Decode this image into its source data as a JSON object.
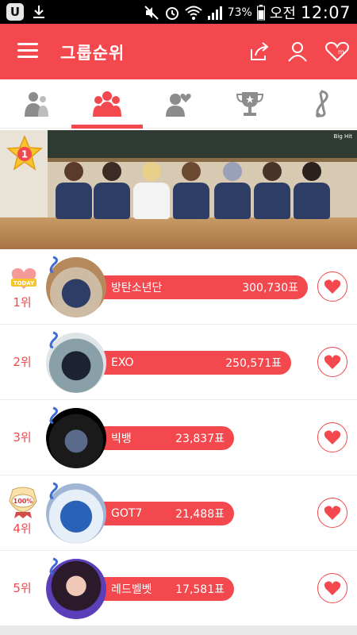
{
  "status_bar": {
    "battery": "73%",
    "ampm": "오전",
    "time": "12:07"
  },
  "header": {
    "title": "그룹순위"
  },
  "tabs": [
    {
      "icon": "individual-ranking-icon"
    },
    {
      "icon": "group-ranking-icon"
    },
    {
      "icon": "heart-person-icon"
    },
    {
      "icon": "trophy-icon"
    },
    {
      "icon": "music-note-icon"
    }
  ],
  "banner": {
    "tag": "Big Hit",
    "medal_number": "1"
  },
  "rankings": [
    {
      "rank": "1위",
      "name": "방탄소년단",
      "votes": "300,730표",
      "badge": "TODAY",
      "bar_fill": 0.59
    },
    {
      "rank": "2위",
      "name": "EXO",
      "votes": "250,571표",
      "badge": "",
      "bar_fill": 0.55
    },
    {
      "rank": "3위",
      "name": "빅뱅",
      "votes": "23,837표",
      "badge": "",
      "bar_fill": 0.39
    },
    {
      "rank": "4위",
      "name": "GOT7",
      "votes": "21,488표",
      "badge": "100%",
      "bar_fill": 0.39
    },
    {
      "rank": "5위",
      "name": "레드벨벳",
      "votes": "17,581표",
      "badge": "",
      "bar_fill": 0.39
    }
  ],
  "colors": {
    "accent": "#f2484e",
    "statusbar": "#000000"
  }
}
